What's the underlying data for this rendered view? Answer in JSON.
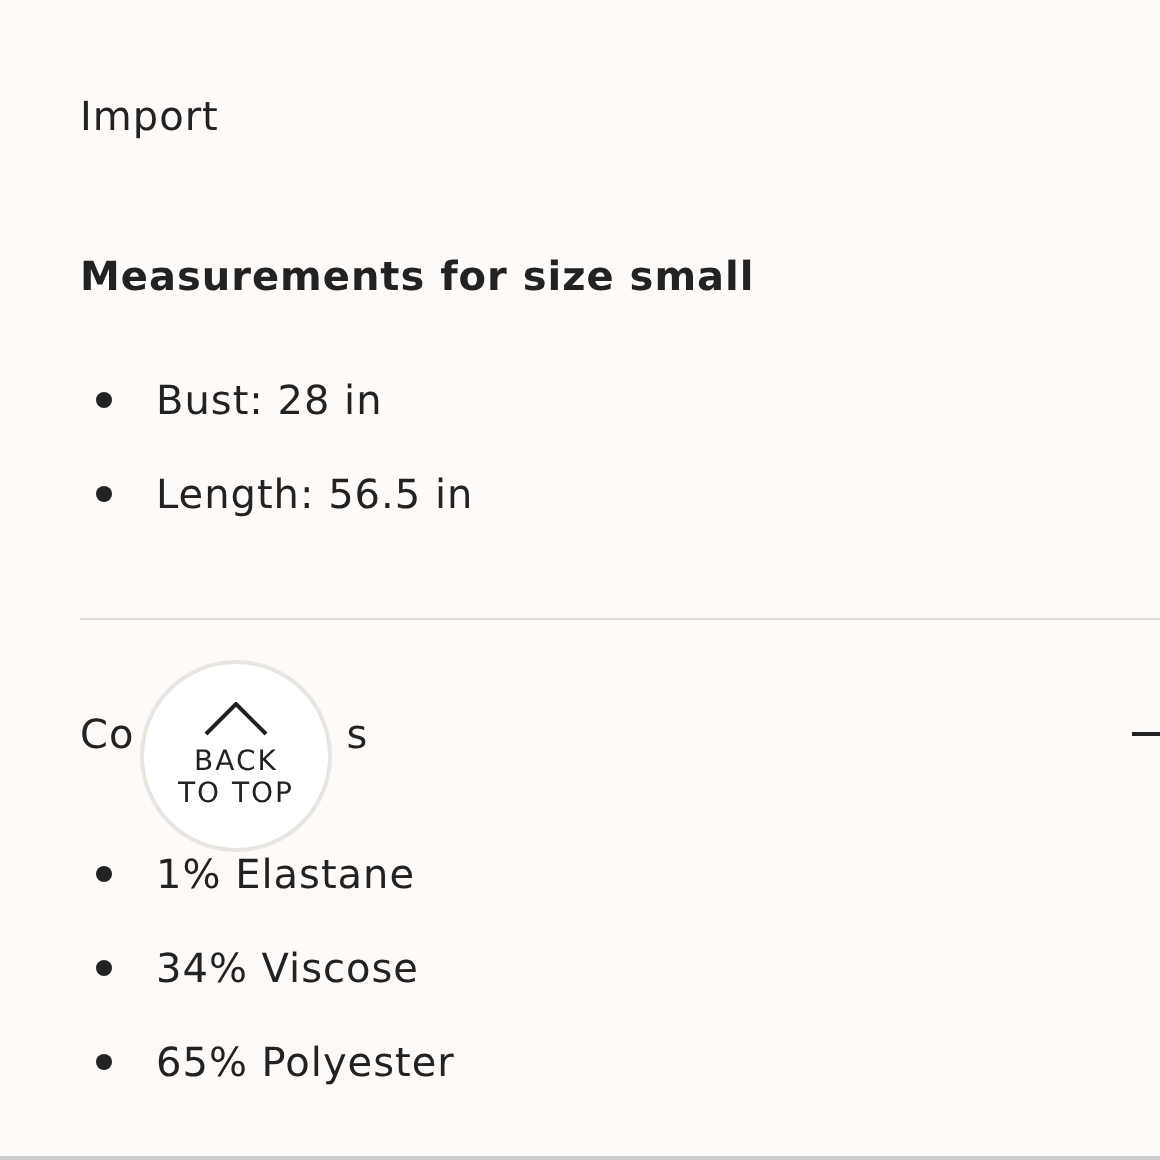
{
  "care": [
    {
      "text": "Import"
    }
  ],
  "measurements": {
    "title": "Measurements for size small",
    "items": [
      "Bust: 28 in",
      "Length: 56.5 in"
    ]
  },
  "section": {
    "title_start": "Co",
    "title_end": "s",
    "expanded": true,
    "items": [
      "1% Elastane",
      "34% Viscose",
      "65% Polyester"
    ]
  },
  "back_to_top": {
    "label_1": "BACK",
    "label_2": "TO TOP"
  }
}
